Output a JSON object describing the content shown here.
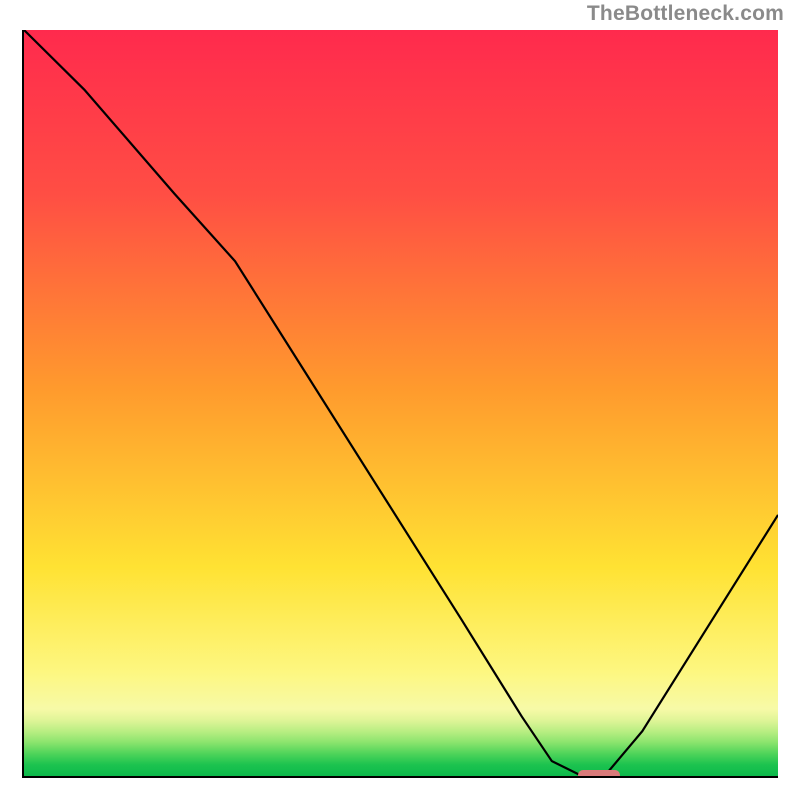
{
  "watermark": "TheBottleneck.com",
  "chart_data": {
    "type": "line",
    "title": "",
    "xlabel": "",
    "ylabel": "",
    "xlim": [
      0,
      100
    ],
    "ylim": [
      0,
      100
    ],
    "grid": false,
    "legend": false,
    "background": {
      "kind": "vertical-gradient",
      "stops": [
        {
          "offset": 0,
          "color": "#ff2a4d"
        },
        {
          "offset": 22,
          "color": "#ff4e44"
        },
        {
          "offset": 48,
          "color": "#ff9a2d"
        },
        {
          "offset": 72,
          "color": "#ffe233"
        },
        {
          "offset": 86,
          "color": "#fdf780"
        },
        {
          "offset": 91,
          "color": "#f7faa7"
        },
        {
          "offset": 92.5,
          "color": "#e0f598"
        },
        {
          "offset": 94,
          "color": "#b9ee83"
        },
        {
          "offset": 95.5,
          "color": "#8be46d"
        },
        {
          "offset": 97,
          "color": "#4fd45a"
        },
        {
          "offset": 98.5,
          "color": "#1cc34f"
        },
        {
          "offset": 100,
          "color": "#0cb94b"
        }
      ]
    },
    "series": [
      {
        "name": "bottleneck-curve",
        "color": "#000000",
        "x": [
          0,
          8,
          20,
          28,
          38,
          48,
          58,
          66,
          70,
          74,
          77,
          82,
          100
        ],
        "values": [
          100,
          92,
          78,
          69,
          53,
          37,
          21,
          8,
          2,
          0,
          0,
          6,
          35
        ]
      }
    ],
    "sweet_spot_marker": {
      "x_start": 73.5,
      "x_end": 79,
      "y": 0,
      "color": "#d97a7a"
    }
  }
}
